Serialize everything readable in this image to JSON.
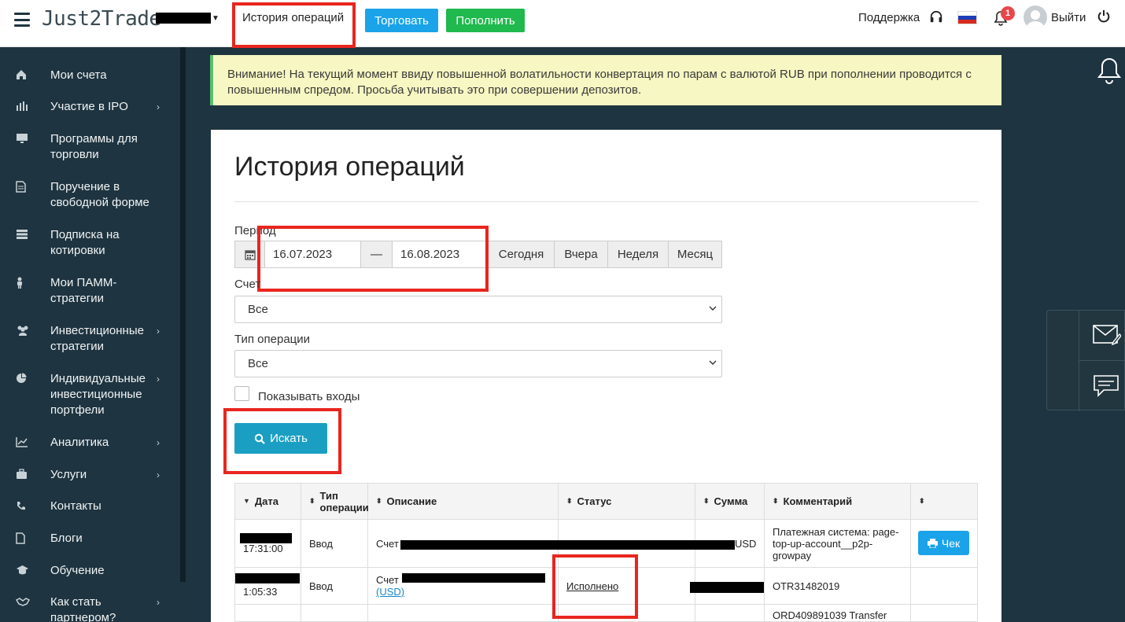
{
  "header": {
    "brand": "Just2Trade",
    "nav_history": "История операций",
    "trade_button": "Торговать",
    "deposit_button": "Пополнить",
    "support": "Поддержка",
    "notification_count": "1",
    "exit": "Выйти"
  },
  "sidebar": {
    "items": [
      {
        "label": "Мои счета",
        "icon": "home-icon"
      },
      {
        "label": "Участие в IPO",
        "icon": "bar-chart-icon"
      },
      {
        "label": "Программы для торговли",
        "icon": "monitor-icon"
      },
      {
        "label": "Поручение в свободной форме",
        "icon": "document-icon"
      },
      {
        "label": "Подписка на котировки",
        "icon": "server-icon"
      },
      {
        "label": "Мои ПАММ-стратегии",
        "icon": "person-icon"
      },
      {
        "label": "Инвестиционные стратегии",
        "icon": "users-icon"
      },
      {
        "label": "Индивидуальные инвестиционные портфели",
        "icon": "pie-chart-icon"
      },
      {
        "label": "Аналитика",
        "icon": "line-chart-icon"
      },
      {
        "label": "Услуги",
        "icon": "briefcase-icon"
      },
      {
        "label": "Контакты",
        "icon": "phone-icon"
      },
      {
        "label": "Блоги",
        "icon": "file-icon"
      },
      {
        "label": "Обучение",
        "icon": "graduation-cap-icon"
      },
      {
        "label": "Как стать партнером?",
        "icon": "handshake-icon"
      }
    ]
  },
  "notice": "Внимание! На текущий момент ввиду повышенной волатильности конвертация по парам с валютой RUB при пополнении проводится с повышенным спредом. Просьба учитывать это при совершении депозитов.",
  "main": {
    "title": "История операций",
    "period_label": "Период",
    "date_from": "16.07.2023",
    "date_separator": "—",
    "date_to": "16.08.2023",
    "quick_ranges": [
      "Сегодня",
      "Вчера",
      "Неделя",
      "Месяц"
    ],
    "account_label": "Счет",
    "account_value": "Все",
    "op_type_label": "Тип операции",
    "op_type_value": "Все",
    "show_logins_label": "Показывать входы",
    "search_button": "Искать"
  },
  "table": {
    "headers": [
      "Дата",
      "Тип операции",
      "Описание",
      "Статус",
      "Сумма",
      "Комментарий",
      ""
    ],
    "rows": [
      {
        "date": "17:31:00",
        "type": "Ввод",
        "desc_prefix": "Счет",
        "desc_suffix": "USD",
        "status": "",
        "sum": "",
        "comment": "Платежная система: page-top-up-account__p2p-growpay",
        "action": "Чек"
      },
      {
        "date": "1:05:33",
        "type": "Ввод",
        "desc_prefix": "Счет",
        "desc_suffix": "(USD)",
        "status": "Исполнено",
        "sum": "",
        "comment": "OTR31482019",
        "action": ""
      },
      {
        "date": "",
        "type": "",
        "desc_prefix": "",
        "desc_suffix": "",
        "status": "",
        "sum": "",
        "comment": "ORD409891039 Transfer",
        "action": ""
      }
    ]
  },
  "colors": {
    "sidebar_bg": "#1e3440",
    "trade_btn": "#1aa3e8",
    "deposit_btn": "#1fb94e",
    "search_btn": "#1a9fc3",
    "highlight": "#e8261f",
    "notice_bg": "#f7f7c3"
  }
}
